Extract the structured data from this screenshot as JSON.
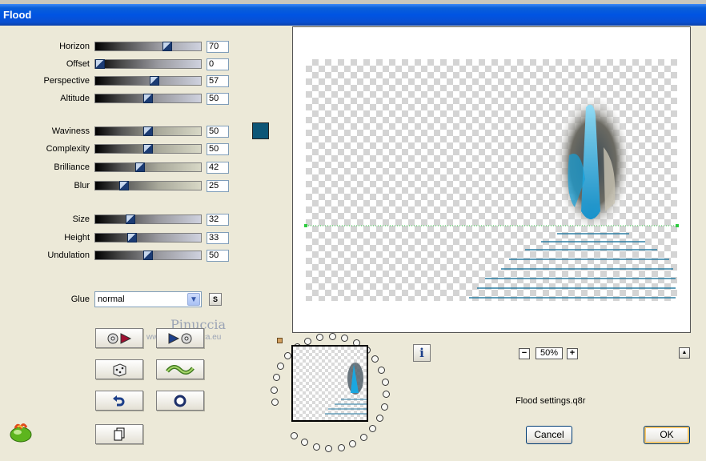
{
  "window": {
    "title": "Flood"
  },
  "sliders_group1": [
    {
      "label": "Horizon",
      "value": "70",
      "pct": 0.7
    },
    {
      "label": "Offset",
      "value": "0",
      "pct": 0.0
    },
    {
      "label": "Perspective",
      "value": "57",
      "pct": 0.57
    },
    {
      "label": "Altitude",
      "value": "50",
      "pct": 0.5
    }
  ],
  "sliders_group2": [
    {
      "label": "Waviness",
      "value": "50",
      "pct": 0.5
    },
    {
      "label": "Complexity",
      "value": "50",
      "pct": 0.5
    },
    {
      "label": "Brilliance",
      "value": "42",
      "pct": 0.42
    },
    {
      "label": "Blur",
      "value": "25",
      "pct": 0.25
    }
  ],
  "sliders_group3": [
    {
      "label": "Size",
      "value": "32",
      "pct": 0.32
    },
    {
      "label": "Height",
      "value": "33",
      "pct": 0.33
    },
    {
      "label": "Undulation",
      "value": "50",
      "pct": 0.5
    }
  ],
  "color": {
    "swatch": "#0d5677"
  },
  "glue": {
    "label": "Glue",
    "value": "normal",
    "s_button": "S"
  },
  "watermark": {
    "name": "Pinuccia",
    "url": "www.marifrgrafica.eu"
  },
  "zoom": {
    "value": "50%",
    "minus": "−",
    "plus": "+"
  },
  "status": {
    "settings_file": "Flood settings.q8r"
  },
  "buttons": {
    "cancel": "Cancel",
    "ok": "OK",
    "info": "i",
    "up": "▲"
  }
}
